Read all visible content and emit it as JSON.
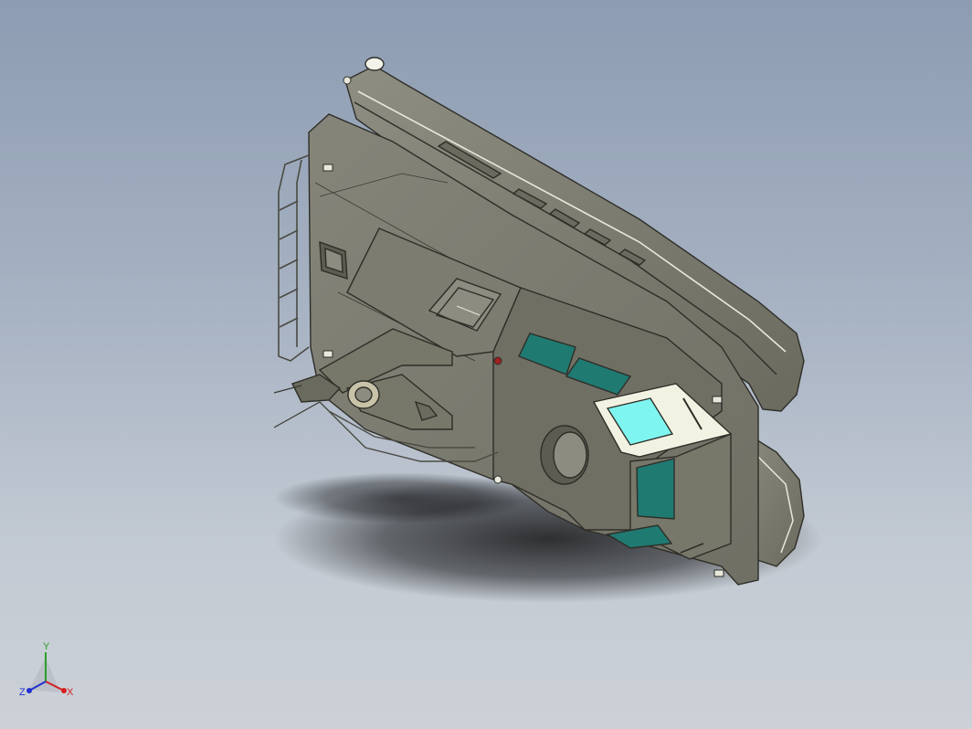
{
  "viewport": {
    "model": "catamaran-hull-assembly"
  },
  "triad": {
    "x_label": "X",
    "y_label": "Y",
    "z_label": "Z",
    "x_color": "#d42020",
    "y_color": "#2aa02a",
    "z_color": "#2030d0"
  },
  "colors": {
    "hull": "#77776a",
    "hull_dark": "#5c5c52",
    "hull_light": "#8c8c80",
    "window_teal": "#1f7a72",
    "window_cyan": "#7ff5f0",
    "roof_cream": "#f2f2e2"
  }
}
